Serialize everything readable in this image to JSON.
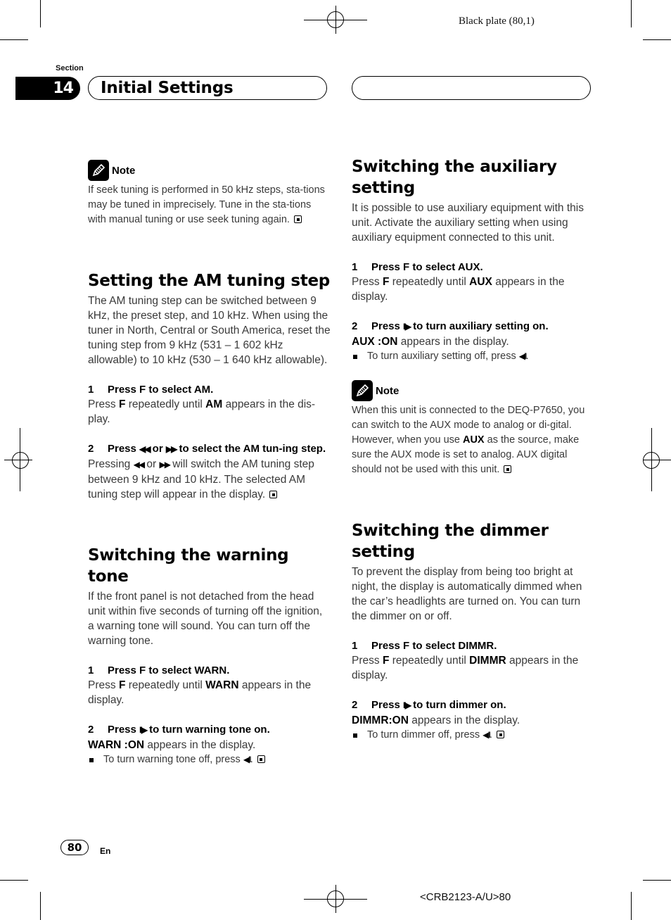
{
  "header": {
    "plate_text": "Black plate (80,1)",
    "section_label": "Section",
    "section_number": "14",
    "section_title": "Initial Settings"
  },
  "left_column": {
    "note1": {
      "label": "Note",
      "icon": "pencil-note-icon",
      "text": "If seek tuning is performed in 50 kHz steps, sta-tions may be tuned in imprecisely. Tune in the sta-tions with manual tuning or use seek tuning again."
    },
    "am_step": {
      "heading": "Setting the AM tuning step",
      "intro": "The AM tuning step can be switched between 9 kHz, the preset step, and 10 kHz. When using the tuner in North, Central or South America, reset the tuning step from 9 kHz (531 – 1 602 kHz allowable) to 10 kHz (530 – 1 640 kHz allowable).",
      "step1": {
        "num": "1",
        "title": "Press F to select AM.",
        "body_pre": "Press ",
        "body_b1": "F",
        "body_mid": " repeatedly until ",
        "body_b2": "AM",
        "body_post": " appears in the dis-play."
      },
      "step2": {
        "num": "2",
        "title_pre": "Press ",
        "sym_rew": "◀◀",
        "title_or": " or ",
        "sym_ff": "▶▶",
        "title_post": " to select the AM tun-ing step.",
        "body_pre": "Pressing ",
        "body_or": " or ",
        "body_post": " will switch the AM tuning step between 9 kHz and 10 kHz. The selected AM tuning step will appear in the display."
      }
    },
    "warning": {
      "heading": "Switching the warning tone",
      "intro": "If the front panel is not detached from the head unit within five seconds of turning off the ignition, a warning tone will sound. You can turn off the warning tone.",
      "step1": {
        "num": "1",
        "title": "Press F to select WARN.",
        "body_pre": "Press ",
        "body_b1": "F",
        "body_mid": " repeatedly until ",
        "body_b2": "WARN",
        "body_post": " appears in the display."
      },
      "step2": {
        "num": "2",
        "title_pre": "Press ",
        "sym_play": "II▶",
        "title_post": " to turn warning tone on.",
        "status_b": "WARN :ON",
        "status_post": " appears in the display.",
        "bullet_pre": "To turn warning tone off, press ",
        "sym_back": "◀II",
        "bullet_post": "."
      }
    }
  },
  "right_column": {
    "aux": {
      "heading": "Switching the auxiliary setting",
      "intro": "It is possible to use auxiliary equipment with this unit. Activate the auxiliary setting when using auxiliary equipment connected to this unit.",
      "step1": {
        "num": "1",
        "title": "Press F to select AUX.",
        "body_pre": "Press ",
        "body_b1": "F",
        "body_mid": " repeatedly until ",
        "body_b2": "AUX",
        "body_post": " appears in the display."
      },
      "step2": {
        "num": "2",
        "title_pre": "Press ",
        "sym_play": "II▶",
        "title_post": " to turn auxiliary setting on.",
        "status_b": "AUX :ON",
        "status_post": " appears in the display.",
        "bullet_pre": "To turn auxiliary setting off, press ",
        "sym_back": "◀II",
        "bullet_post": "."
      },
      "note": {
        "label": "Note",
        "icon": "pencil-note-icon",
        "text_pre": "When this unit is connected to the DEQ-P7650, you can switch to the AUX mode to analog or di-gital. However, when you use ",
        "text_b": "AUX",
        "text_post": " as the source, make sure the AUX mode is set to analog. AUX digital should not be used with this unit."
      }
    },
    "dimmer": {
      "heading": "Switching the dimmer setting",
      "intro": "To prevent the display from being too bright at night, the display is automatically dimmed when the car’s headlights are turned on. You can turn the dimmer on or off.",
      "step1": {
        "num": "1",
        "title": "Press F to select DIMMR.",
        "body_pre": "Press ",
        "body_b1": "F",
        "body_mid": " repeatedly until ",
        "body_b2": "DIMMR",
        "body_post": " appears in the display."
      },
      "step2": {
        "num": "2",
        "title_pre": "Press ",
        "sym_play": "II▶",
        "title_post": " to turn dimmer on.",
        "status_b": "DIMMR:ON",
        "status_post": " appears in the display.",
        "bullet_pre": "To turn dimmer off, press ",
        "sym_back": "◀II",
        "bullet_post": "."
      }
    }
  },
  "footer": {
    "page_number": "80",
    "language": "En",
    "doc_code": "<CRB2123-A/U>80"
  }
}
